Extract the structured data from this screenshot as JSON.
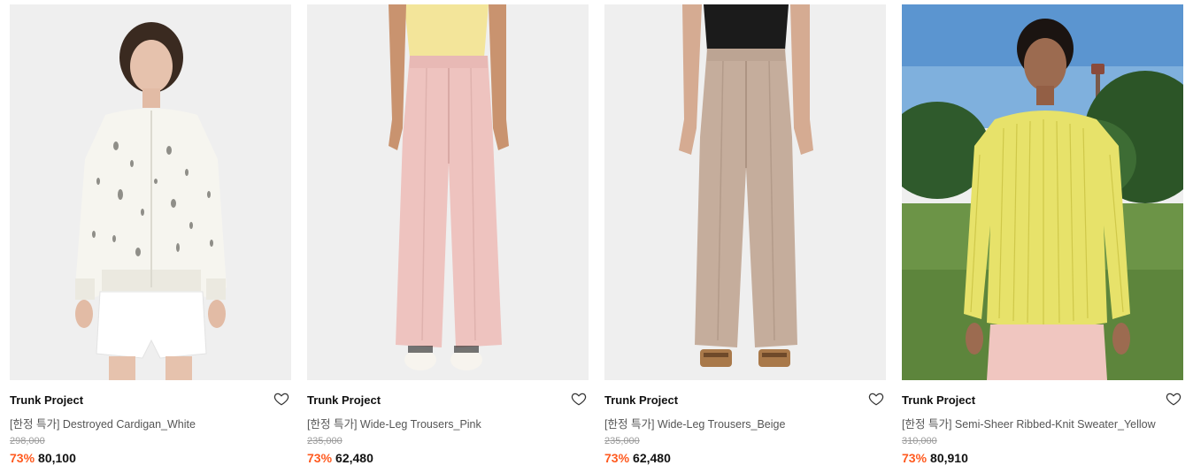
{
  "products": [
    {
      "brand": "Trunk Project",
      "name": "[한정 특가] Destroyed Cardigan_White",
      "original_price": "298,000",
      "discount": "73%",
      "price": "80,100",
      "wishlist_icon": "heart-outline-icon"
    },
    {
      "brand": "Trunk Project",
      "name": "[한정 특가] Wide-Leg Trousers_Pink",
      "original_price": "235,000",
      "discount": "73%",
      "price": "62,480",
      "wishlist_icon": "heart-outline-icon"
    },
    {
      "brand": "Trunk Project",
      "name": "[한정 특가] Wide-Leg Trousers_Beige",
      "original_price": "235,000",
      "discount": "73%",
      "price": "62,480",
      "wishlist_icon": "heart-outline-icon"
    },
    {
      "brand": "Trunk Project",
      "name": "[한정 특가] Semi-Sheer Ribbed-Knit Sweater_Yellow",
      "original_price": "310,000",
      "discount": "73%",
      "price": "80,910",
      "wishlist_icon": "heart-outline-icon"
    }
  ],
  "colors": {
    "discount": "#ff5a1f",
    "text": "#111111",
    "muted": "#555555",
    "strike": "#9a9a9a",
    "photo_bg": "#efefef"
  }
}
